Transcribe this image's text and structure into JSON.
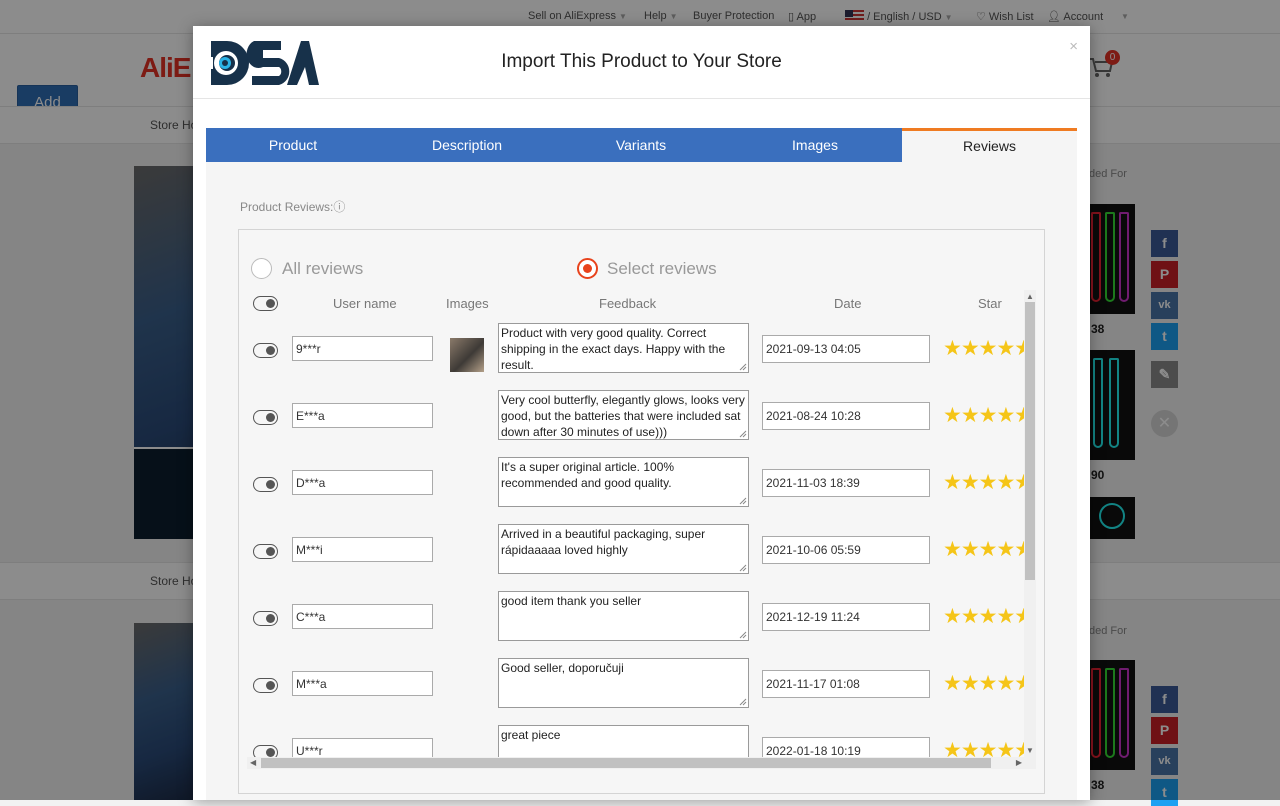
{
  "topbar": {
    "sell": "Sell on AliExpress",
    "help": "Help",
    "buyer_protection": "Buyer Protection",
    "app": "App",
    "language": "/ English /",
    "currency": "USD",
    "wishlist": "Wish List",
    "account": "Account"
  },
  "header": {
    "logo_text": "AliE",
    "cart_count": "0"
  },
  "page": {
    "add_button": "Add",
    "store_home": "Store Ho",
    "recommended": "ded For",
    "prices": [
      "38",
      "90",
      "38"
    ]
  },
  "modal": {
    "title": "Import This Product to Your Store",
    "close": "×",
    "tabs": [
      "Product",
      "Description",
      "Variants",
      "Images",
      "Reviews"
    ],
    "active_tab": "Reviews",
    "section_label": "Product Reviews:",
    "info_icon": "ⓘ",
    "radio_all": "All reviews",
    "radio_select": "Select reviews",
    "columns": {
      "user": "User name",
      "images": "Images",
      "feedback": "Feedback",
      "date": "Date",
      "star": "Star"
    },
    "reviews": [
      {
        "user": "9***r",
        "has_image": true,
        "feedback": "Product with very good quality. Correct shipping in the exact days. Happy with the result.",
        "date": "2021-09-13 04:05",
        "stars": 5
      },
      {
        "user": "E***a",
        "has_image": false,
        "feedback": "Very cool butterfly, elegantly glows, looks very good, but the batteries that were included sat down after 30 minutes of use)))",
        "date": "2021-08-24 10:28",
        "stars": 5
      },
      {
        "user": "D***a",
        "has_image": false,
        "feedback": "It's a super original article. 100% recommended and good quality.",
        "date": "2021-11-03 18:39",
        "stars": 5
      },
      {
        "user": "M***i",
        "has_image": false,
        "feedback": "Arrived in a beautiful packaging, super rápidaaaaa loved highly",
        "date": "2021-10-06 05:59",
        "stars": 5
      },
      {
        "user": "C***a",
        "has_image": false,
        "feedback": "good item thank you seller",
        "date": "2021-12-19 11:24",
        "stars": 5
      },
      {
        "user": "M***a",
        "has_image": false,
        "feedback": "Good seller, doporučuji",
        "date": "2021-11-17 01:08",
        "stars": 5
      },
      {
        "user": "U***r",
        "has_image": false,
        "feedback": "great piece",
        "date": "2022-01-18 10:19",
        "stars": 5
      }
    ]
  },
  "colors": {
    "tab_blue": "#3a6fbe",
    "tab_active_border": "#ef7b22",
    "radio_on": "#e8431c",
    "star": "#f5c518",
    "ali_red": "#e43225"
  }
}
